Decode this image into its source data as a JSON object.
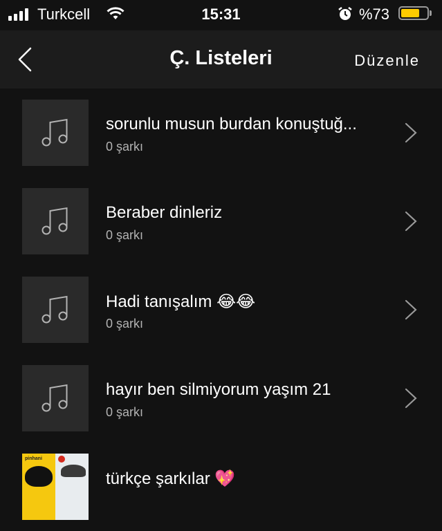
{
  "status_bar": {
    "carrier": "Turkcell",
    "time": "15:31",
    "battery_percent": "%73",
    "battery_level": 0.73,
    "icons": [
      "signal-icon",
      "wifi-icon",
      "alarm-icon",
      "battery-icon"
    ]
  },
  "nav": {
    "back_icon": "chevron-left-icon",
    "title": "Ç. Listeleri",
    "edit_label": "Düzenle"
  },
  "playlists": [
    {
      "title": "sorunlu musun burdan konuştuğ...",
      "subtitle": "0 şarkı",
      "cover": "music-note-icon"
    },
    {
      "title": "Beraber dinleriz",
      "subtitle": "0 şarkı",
      "cover": "music-note-icon"
    },
    {
      "title": "Hadi tanışalım 😂😂",
      "subtitle": "0 şarkı",
      "cover": "music-note-icon"
    },
    {
      "title": "hayır ben silmiyorum yaşım 21",
      "subtitle": "0 şarkı",
      "cover": "music-note-icon"
    },
    {
      "title": "türkçe şarkılar 💖",
      "subtitle": "",
      "cover": "album-art",
      "cover_text": "pinhani"
    }
  ],
  "colors": {
    "background": "#121212",
    "nav_background": "#1c1c1c",
    "cover_placeholder": "#2a2a2a",
    "subtitle": "#b3b3b3",
    "battery": "#ffcc00"
  }
}
